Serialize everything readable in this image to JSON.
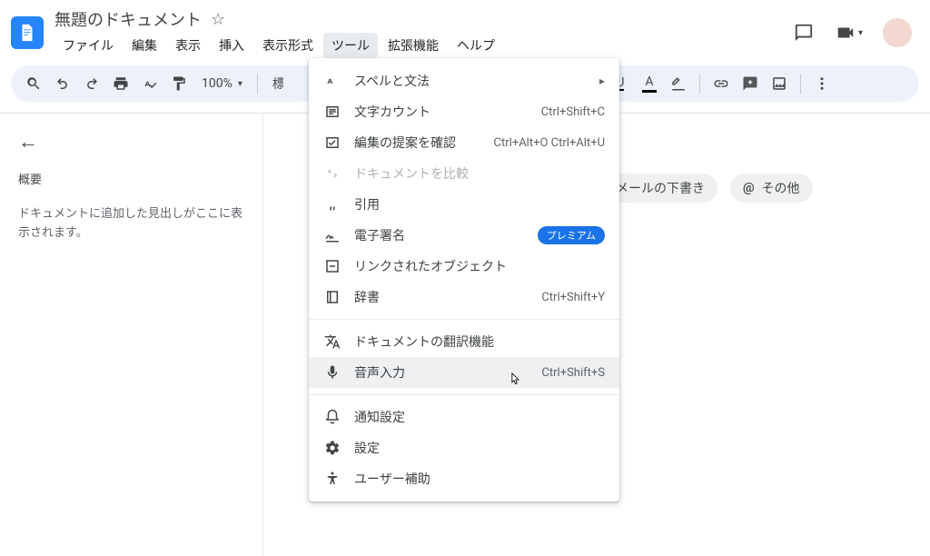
{
  "header": {
    "doc_title": "無題のドキュメント",
    "menus": [
      "ファイル",
      "編集",
      "表示",
      "挿入",
      "表示形式",
      "ツール",
      "拡張機能",
      "ヘルプ"
    ],
    "active_menu_index": 5
  },
  "toolbar": {
    "zoom": "100%",
    "style_hint": "標"
  },
  "sidebar": {
    "overview_label": "概要",
    "outline_placeholder": "ドキュメントに追加した見出しがここに表示されます。"
  },
  "chips": [
    {
      "label": "メールの下書き"
    },
    {
      "label": "その他"
    }
  ],
  "tools_menu": {
    "items": [
      {
        "icon": "spellcheck",
        "label": "スペルと文法",
        "submenu": true
      },
      {
        "icon": "count",
        "label": "文字カウント",
        "shortcut": "Ctrl+Shift+C"
      },
      {
        "icon": "suggest",
        "label": "編集の提案を確認",
        "shortcut": "Ctrl+Alt+O Ctrl+Alt+U"
      },
      {
        "icon": "compare",
        "label": "ドキュメントを比較",
        "disabled": true
      },
      {
        "icon": "quote",
        "label": "引用"
      },
      {
        "icon": "signature",
        "label": "電子署名",
        "badge": "プレミアム"
      },
      {
        "icon": "link",
        "label": "リンクされたオブジェクト"
      },
      {
        "icon": "dictionary",
        "label": "辞書",
        "shortcut": "Ctrl+Shift+Y"
      },
      {
        "separator": true
      },
      {
        "icon": "translate",
        "label": "ドキュメントの翻訳機能"
      },
      {
        "icon": "mic",
        "label": "音声入力",
        "shortcut": "Ctrl+Shift+S",
        "hovered": true
      },
      {
        "separator": true
      },
      {
        "icon": "bell",
        "label": "通知設定"
      },
      {
        "icon": "gear",
        "label": "設定"
      },
      {
        "icon": "accessibility",
        "label": "ユーザー補助"
      }
    ]
  }
}
